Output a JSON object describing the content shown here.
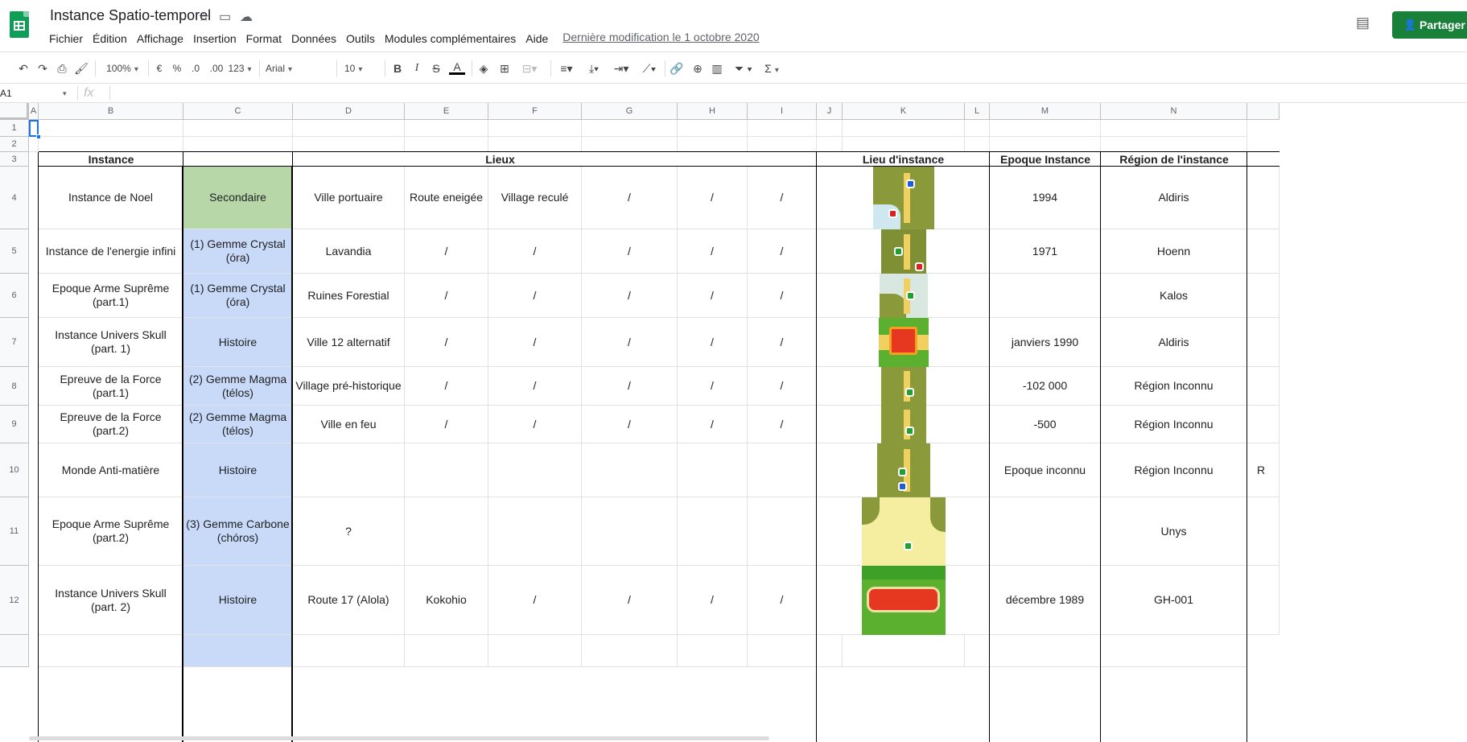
{
  "header": {
    "title": "Instance Spatio-temporel",
    "menus": [
      "Fichier",
      "Édition",
      "Affichage",
      "Insertion",
      "Format",
      "Données",
      "Outils",
      "Modules complémentaires",
      "Aide"
    ],
    "last_edit": "Dernière modification le 1 octobre 2020",
    "share_label": "Partager",
    "icons": {
      "star": "star-icon",
      "move": "move-to-folder-icon",
      "cloud": "cloud-status-icon",
      "comments": "comments-icon"
    }
  },
  "toolbar": {
    "zoom": "100%",
    "currency": "€",
    "percent": "%",
    "decrease_decimals": ".0",
    "increase_decimals": ".00",
    "number_format": "123",
    "font": "Arial",
    "font_size": "10",
    "bold": "B",
    "italic": "I",
    "strike": "S",
    "text_color": "A",
    "sum": "Σ"
  },
  "formula_bar": {
    "cell_ref": "A1",
    "fx": "fx"
  },
  "columns": [
    "A",
    "B",
    "C",
    "D",
    "E",
    "F",
    "G",
    "H",
    "I",
    "J",
    "K",
    "L",
    "M",
    "N"
  ],
  "rows": [
    "1",
    "2",
    "3",
    "4",
    "5",
    "6",
    "7",
    "8",
    "9",
    "10",
    "11",
    "12"
  ],
  "table": {
    "headers": {
      "instance": "Instance",
      "lieux": "Lieux",
      "lieu_instance": "Lieu d'instance",
      "epoque": "Epoque Instance",
      "region": "Région de l'instance"
    },
    "rows": [
      {
        "instance": "Instance de Noel",
        "type": "Secondaire",
        "type_color": "#b7d7a8",
        "d": "Ville portuaire",
        "e": "Route eneigée",
        "f": "Village reculé",
        "g": "/",
        "h": "/",
        "i": "/",
        "epoque": "1994",
        "region": "Aldiris",
        "o": "",
        "map": "map-noel-thumbnail"
      },
      {
        "instance": "Instance de l'energie infini",
        "type": "(1) Gemme Crystal (óra)",
        "type_color": "#c9daf8",
        "d": "Lavandia",
        "e": "/",
        "f": "/",
        "g": "/",
        "h": "/",
        "i": "/",
        "epoque": "1971",
        "region": "Hoenn",
        "o": "",
        "map": "map-lavandia-thumbnail"
      },
      {
        "instance": "Epoque Arme Suprême (part.1)",
        "type": "(1) Gemme Crystal (óra)",
        "type_color": "#c9daf8",
        "d": "Ruines Forestial",
        "e": "/",
        "f": "/",
        "g": "/",
        "h": "/",
        "i": "/",
        "epoque": "",
        "region": "Kalos",
        "o": "",
        "map": "map-ruines-thumbnail"
      },
      {
        "instance": "Instance Univers Skull (part. 1)",
        "type": "Histoire",
        "type_color": "#c9daf8",
        "d": "Ville 12 alternatif",
        "e": "/",
        "f": "/",
        "g": "/",
        "h": "/",
        "i": "/",
        "epoque": "janviers 1990",
        "region": "Aldiris",
        "o": "",
        "map": "map-ville12-thumbnail"
      },
      {
        "instance": "Epreuve de la Force (part.1)",
        "type": "(2) Gemme Magma (télos)",
        "type_color": "#c9daf8",
        "d": "Village pré-historique",
        "e": "/",
        "f": "/",
        "g": "/",
        "h": "/",
        "i": "/",
        "epoque": "-102 000",
        "region": "Région Inconnu",
        "o": "",
        "map": "map-village-prehistorique-thumbnail"
      },
      {
        "instance": "Epreuve de la Force (part.2)",
        "type": "(2) Gemme Magma (télos)",
        "type_color": "#c9daf8",
        "d": "Ville en feu",
        "e": "/",
        "f": "/",
        "g": "/",
        "h": "/",
        "i": "/",
        "epoque": "-500",
        "region": "Région Inconnu",
        "o": "",
        "map": "map-ville-en-feu-thumbnail"
      },
      {
        "instance": "Monde Anti-matière",
        "type": "Histoire",
        "type_color": "#c9daf8",
        "d": "",
        "e": "",
        "f": "",
        "g": "",
        "h": "",
        "i": "",
        "epoque": "Epoque inconnu",
        "region": "Région Inconnu",
        "o": "R",
        "map": "map-anti-matiere-thumbnail"
      },
      {
        "instance": "Epoque Arme Suprême (part.2)",
        "type": "(3) Gemme Carbone (chóros)",
        "type_color": "#c9daf8",
        "d": "?",
        "e": "",
        "f": "",
        "g": "",
        "h": "",
        "i": "",
        "epoque": "",
        "region": "Unys",
        "o": "",
        "map": "map-desert-thumbnail"
      },
      {
        "instance": "Instance Univers Skull (part. 2)",
        "type": "Histoire",
        "type_color": "#c9daf8",
        "d": "Route 17 (Alola)",
        "e": "Kokohio",
        "f": "/",
        "g": "/",
        "h": "/",
        "i": "/",
        "epoque": "décembre 1989",
        "region": "GH-001",
        "o": "",
        "map": "map-route17-thumbnail"
      }
    ]
  }
}
